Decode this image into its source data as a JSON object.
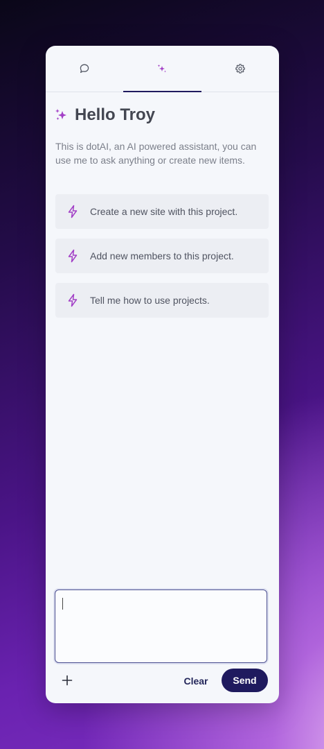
{
  "tabs": [
    {
      "name": "chat",
      "icon": "chat-bubble-icon",
      "active": false
    },
    {
      "name": "assistant",
      "icon": "sparkles-icon",
      "active": true
    },
    {
      "name": "settings",
      "icon": "gear-icon",
      "active": false
    }
  ],
  "greeting": {
    "title": "Hello Troy",
    "icon": "sparkles-icon"
  },
  "intro": "This is dotAI, an AI powered assistant, you can use me to ask anything or create new items.",
  "suggestions": [
    {
      "label": "Create a new site with this project.",
      "icon": "lightning-bolt-icon"
    },
    {
      "label": "Add new members to this project.",
      "icon": "lightning-bolt-icon"
    },
    {
      "label": "Tell me how to use projects.",
      "icon": "lightning-bolt-icon"
    }
  ],
  "input": {
    "value": "",
    "placeholder": ""
  },
  "footer": {
    "add_icon": "plus-icon",
    "clear_label": "Clear",
    "send_label": "Send"
  },
  "colors": {
    "accent": "#1f1a5e",
    "icon_purple": "#a23fc6",
    "panel_bg": "#f5f7fb",
    "suggestion_bg": "#eceef3"
  }
}
